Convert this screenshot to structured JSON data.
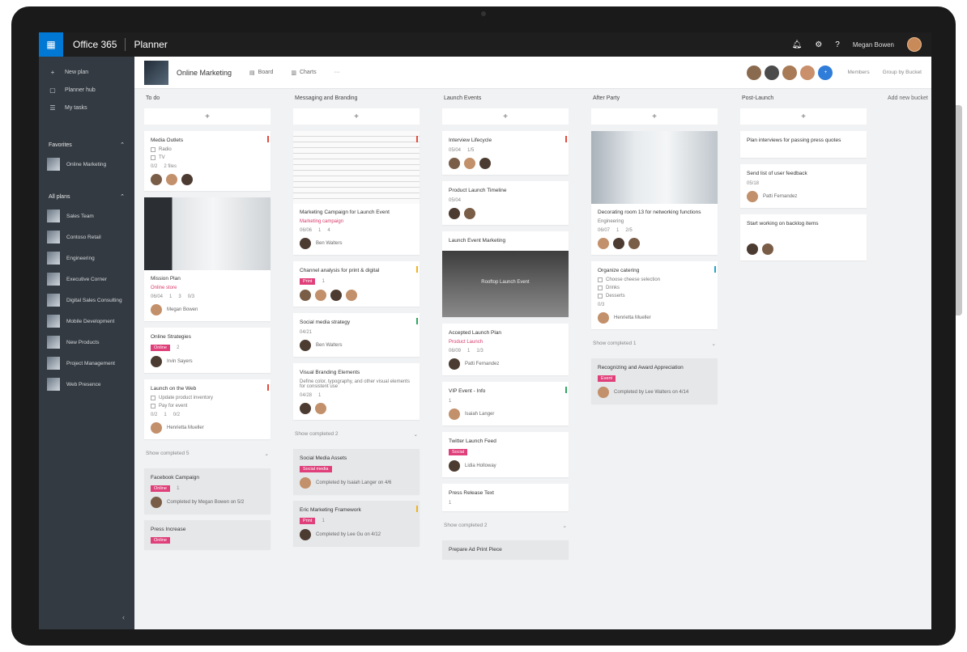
{
  "topbar": {
    "brand": "Office 365",
    "app": "Planner",
    "user": "Megan Bowen",
    "icons": [
      "bell-icon",
      "gear-icon",
      "help-icon"
    ]
  },
  "leftnav": {
    "items": [
      {
        "icon": "plus-icon",
        "label": "New plan"
      },
      {
        "icon": "hub-icon",
        "label": "Planner hub"
      },
      {
        "icon": "my-tasks-icon",
        "label": "My tasks"
      }
    ],
    "favorites_label": "Favorites",
    "favorites": [
      "Online Marketing"
    ],
    "all_plans_label": "All plans",
    "plans": [
      "Sales Team",
      "Contoso Retail",
      "Engineering",
      "Executive Corner",
      "Digital Sales Consulting",
      "Mobile Development",
      "New Products",
      "Project Management",
      "Web Presence"
    ]
  },
  "planhead": {
    "title": "Online Marketing",
    "tabs": [
      "Board",
      "Charts",
      "···"
    ],
    "members_label": "Members",
    "group_label": "Group by Bucket"
  },
  "board": {
    "add_bucket": "Add new bucket",
    "completed_label": "Show completed",
    "columns": [
      {
        "title": "To do",
        "completed_count": "5",
        "cards": [
          {
            "title": "Media Outlets",
            "checks": [
              "Radio",
              "TV"
            ],
            "meta": [
              "0/2",
              "2 files"
            ]
          },
          {
            "title": "Mission Plan",
            "meta": [
              "Online store",
              "06/04",
              "1",
              "3",
              "0/3"
            ],
            "assignee": "Megan Bowen"
          },
          {
            "title": "Online Strategies",
            "label": "Online",
            "meta": [
              "2"
            ],
            "assignee": "Irvin Sayers"
          },
          {
            "title": "Launch on the Web",
            "checks": [
              "Update product inventory",
              "Pay for event"
            ],
            "meta": [
              "0/2",
              "1",
              "0/2"
            ],
            "assignee": "Henrietta Mueller"
          }
        ],
        "completed_cards": [
          {
            "title": "Facebook Campaign",
            "label": "Online",
            "meta": [
              "1"
            ],
            "assignee": "Completed by Megan Bowen on 5/2"
          },
          {
            "title": "Press Increase",
            "label": "Online"
          }
        ]
      },
      {
        "title": "Messaging and Branding",
        "completed_count": "2",
        "cards": [
          {
            "title": "Marketing Campaign for Launch Event",
            "meta": [
              "Marketing campaign",
              "06/06",
              "1",
              "4"
            ],
            "assignee": "Ben Walters"
          },
          {
            "title": "Channel analysis for print & digital",
            "label": "Print",
            "meta": [
              "1"
            ]
          },
          {
            "title": "Social media strategy",
            "meta": [
              "04/21"
            ],
            "assignee": "Ben Walters"
          },
          {
            "title": "Visual Branding Elements",
            "desc": "Define color, typography, and other visual elements for consistent use",
            "meta": [
              "04/28",
              "1"
            ]
          }
        ],
        "completed_cards": [
          {
            "title": "Social Media Assets",
            "label": "Social media",
            "assignee": "Completed by Isaiah Langer on 4/6"
          },
          {
            "title": "Eric Marketing Framework",
            "label": "Print",
            "meta": [
              "1"
            ],
            "assignee": "Completed by Lee Gu on 4/12"
          }
        ]
      },
      {
        "title": "Launch Events",
        "completed_count": "2",
        "cards": [
          {
            "title": "Interview Lifecycle",
            "meta": [
              "05/04",
              "1/5"
            ]
          },
          {
            "title": "Product Launch Timeline",
            "meta": [
              "05/04"
            ]
          },
          {
            "title": "Launch Event Marketing",
            "image_caption": "Rooftop Launch Event"
          },
          {
            "title": "Accepted Launch Plan",
            "meta": [
              "Product Launch",
              "06/09",
              "1",
              "1/3"
            ],
            "assignee": "Patti Fernandez"
          },
          {
            "title": "VIP Event - Info",
            "meta": [
              "1"
            ],
            "assignee": "Isaiah Langer"
          },
          {
            "title": "Twitter Launch Feed",
            "label": "Social",
            "assignee": "Lidia Holloway"
          },
          {
            "title": "Press Release Text",
            "meta": [
              "1"
            ]
          }
        ],
        "completed_cards": [
          {
            "title": "Prepare Ad Print Piece"
          }
        ]
      },
      {
        "title": "After Party",
        "completed_count": "1",
        "cards": [
          {
            "title": "Decorating room 13 for networking functions",
            "meta": [
              "Engineering",
              "06/07",
              "1",
              "2/5"
            ]
          },
          {
            "title": "Organize catering",
            "checks": [
              "Choose cheese selection",
              "Drinks",
              "Desserts"
            ],
            "meta": [
              "0/3"
            ],
            "assignee": "Henrietta Mueller"
          }
        ],
        "completed_cards": [
          {
            "title": "Recognizing and Award Appreciation",
            "label": "Event",
            "assignee": "Completed by Lee Walters on 4/14"
          }
        ]
      },
      {
        "title": "Post-Launch",
        "cards": [
          {
            "title": "Plan interviews for passing press quotes"
          },
          {
            "title": "Send list of user feedback",
            "meta": [
              "05/18"
            ],
            "assignee": "Patti Fernandez"
          },
          {
            "title": "Start working on backlog items"
          }
        ]
      }
    ]
  }
}
